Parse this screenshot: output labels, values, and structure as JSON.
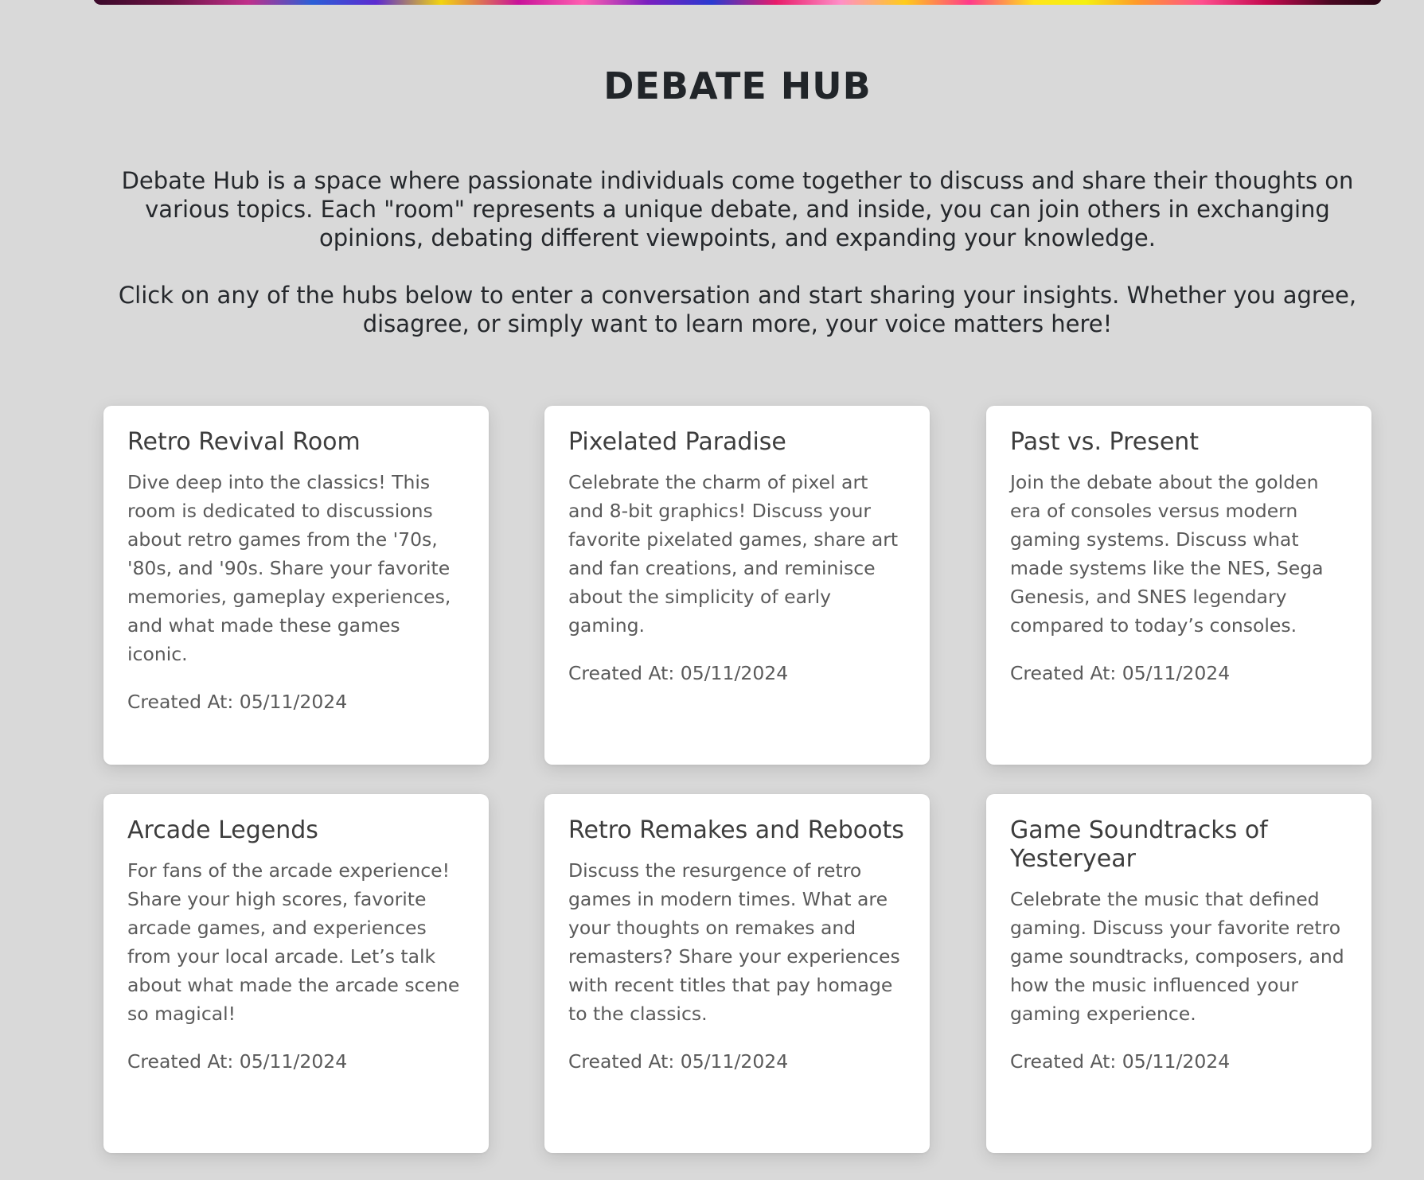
{
  "page": {
    "title": "DEBATE HUB",
    "intro_paragraph_1": "Debate Hub is a space where passionate individuals come together to discuss and share their thoughts on various topics. Each \"room\" represents a unique debate, and inside, you can join others in exchanging opinions, debating different viewpoints, and expanding your knowledge.",
    "intro_paragraph_2": "Click on any of the hubs below to enter a conversation and start sharing your insights. Whether you agree, disagree, or simply want to learn more, your voice matters here!"
  },
  "hubs": [
    {
      "title": "Retro Revival Room",
      "description": "Dive deep into the classics! This room is dedicated to discussions about retro games from the '70s, '80s, and '90s. Share your favorite memories, gameplay experiences, and what made these games iconic.",
      "created": "Created At: 05/11/2024"
    },
    {
      "title": "Pixelated Paradise",
      "description": "Celebrate the charm of pixel art and 8-bit graphics! Discuss your favorite pixelated games, share art and fan creations, and reminisce about the simplicity of early gaming.",
      "created": "Created At: 05/11/2024"
    },
    {
      "title": "Past vs. Present",
      "description": "Join the debate about the golden era of consoles versus modern gaming systems. Discuss what made systems like the NES, Sega Genesis, and SNES legendary compared to today’s consoles.",
      "created": "Created At: 05/11/2024"
    },
    {
      "title": "Arcade Legends",
      "description": "For fans of the arcade experience! Share your high scores, favorite arcade games, and experiences from your local arcade. Let’s talk about what made the arcade scene so magical!",
      "created": "Created At: 05/11/2024"
    },
    {
      "title": "Retro Remakes and Reboots",
      "description": "Discuss the resurgence of retro games in modern times. What are your thoughts on remakes and remasters? Share your experiences with recent titles that pay homage to the classics.",
      "created": "Created At: 05/11/2024"
    },
    {
      "title": "Game Soundtracks of Yesteryear",
      "description": "Celebrate the music that defined gaming. Discuss your favorite retro game soundtracks, composers, and how the music influenced your gaming experience.",
      "created": "Created At: 05/11/2024"
    }
  ]
}
